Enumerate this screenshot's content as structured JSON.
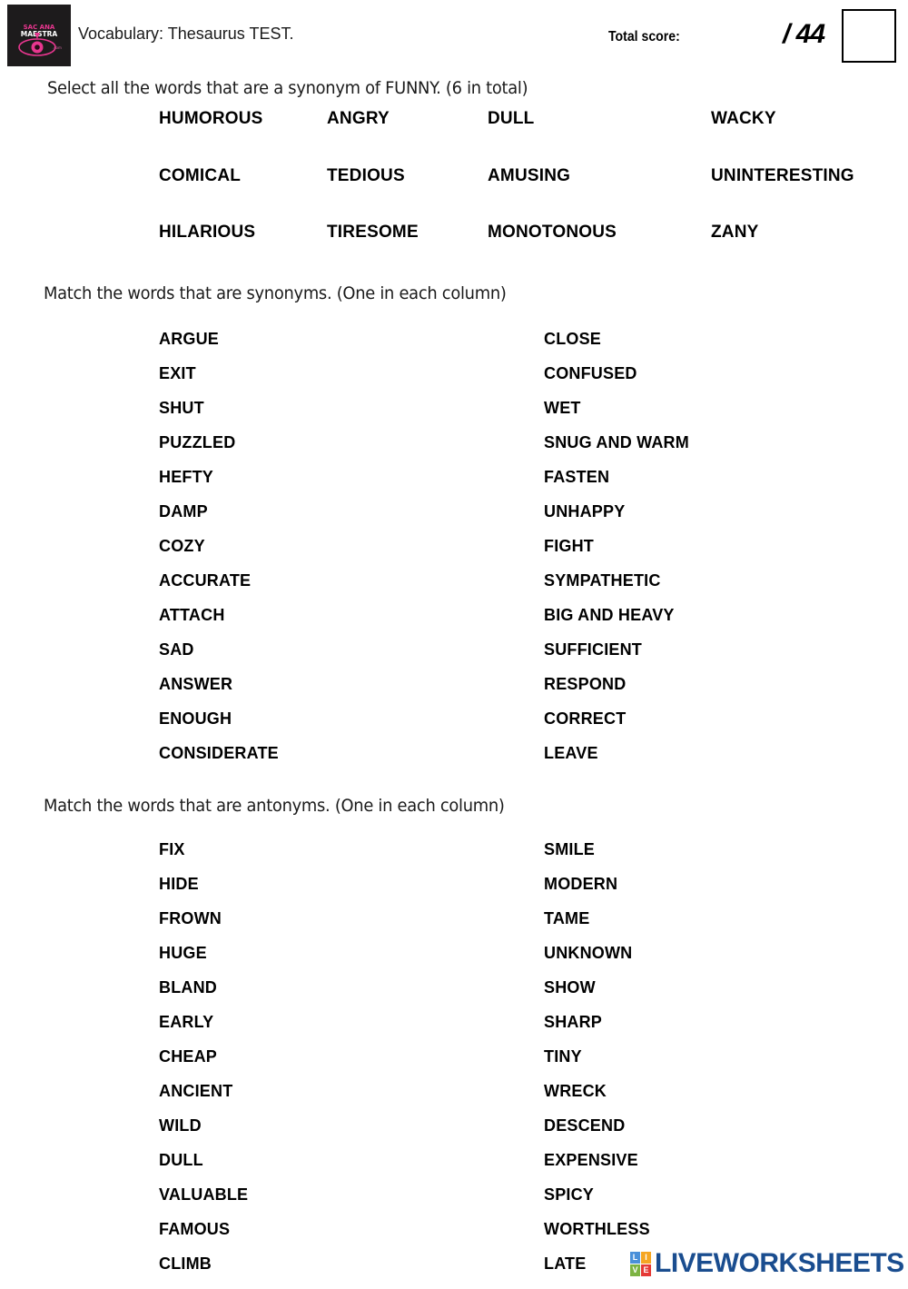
{
  "header": {
    "logo_alt": "school-logo",
    "title": "Vocabulary: Thesaurus TEST.",
    "total_score_label": "Total score:",
    "score_max": "/ 44",
    "score_value": ""
  },
  "sections": [
    {
      "id": "synonyms-of-funny",
      "instruction": "Select all the words that are a synonym of FUNNY. (6 in total)",
      "layout": "grid",
      "rows": [
        [
          "HUMOROUS",
          "ANGRY",
          "DULL",
          "WACKY"
        ],
        [
          "COMICAL",
          "TEDIOUS",
          "AMUSING",
          "UNINTERESTING"
        ],
        [
          "HILARIOUS",
          "TIRESOME",
          "MONOTONOUS",
          "ZANY"
        ]
      ]
    },
    {
      "id": "match-synonyms",
      "instruction": "Match the words that are synonyms. (One in each column)",
      "layout": "two-column",
      "left_column": [
        "ARGUE",
        "EXIT",
        "SHUT",
        "PUZZLED",
        "HEFTY",
        "DAMP",
        "COZY",
        "ACCURATE",
        "ATTACH",
        "SAD",
        "ANSWER",
        "ENOUGH",
        "CONSIDERATE"
      ],
      "right_column": [
        "CLOSE",
        "CONFUSED",
        "WET",
        "SNUG AND WARM",
        "FASTEN",
        "UNHAPPY",
        "FIGHT",
        "SYMPATHETIC",
        "BIG AND HEAVY",
        "SUFFICIENT",
        "RESPOND",
        "CORRECT",
        "LEAVE"
      ]
    },
    {
      "id": "match-antonyms",
      "instruction": "Match the words that are antonyms. (One in each column)",
      "layout": "two-column",
      "left_column": [
        "FIX",
        "HIDE",
        "FROWN",
        "HUGE",
        "BLAND",
        "EARLY",
        "CHEAP",
        "ANCIENT",
        "WILD",
        "DULL",
        "VALUABLE",
        "FAMOUS",
        "CLIMB"
      ],
      "right_column": [
        "SMILE",
        "MODERN",
        "TAME",
        "UNKNOWN",
        "SHOW",
        "SHARP",
        "TINY",
        "WRECK",
        "DESCEND",
        "EXPENSIVE",
        "SPICY",
        "WORTHLESS",
        "LATE"
      ]
    }
  ],
  "footer": {
    "watermark_tiles": [
      "L",
      "I",
      "V",
      "E"
    ],
    "watermark_text": "LIVEWORKSHEETS"
  },
  "colors": {
    "page_background": "#ffffff",
    "text": "#000000",
    "logo_background": "#1d1b1c",
    "logo_accent": "#e8368f",
    "watermark_blue": "#1a4d8f",
    "tile_l": "#4a90d9",
    "tile_i": "#f5a623",
    "tile_v": "#7cb342",
    "tile_e": "#e53935"
  }
}
